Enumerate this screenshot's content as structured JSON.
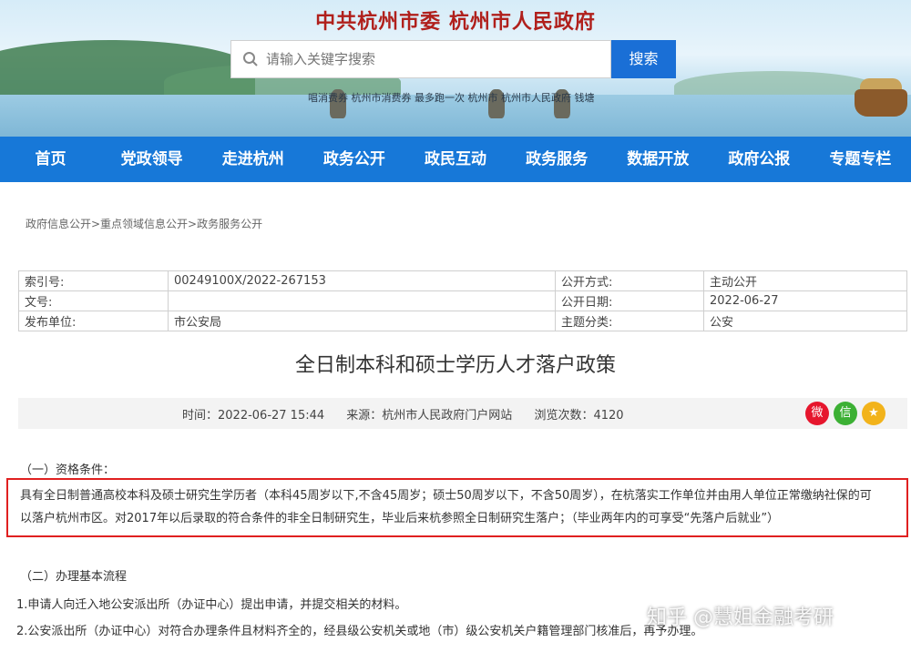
{
  "header": {
    "site_title": "中共杭州市委   杭州市人民政府",
    "search_placeholder": "请输入关键字搜索",
    "search_button": "搜索",
    "hot_links": "唱消费券  杭州市消费券  最多跑一次  杭州市  杭州市人民政府  钱塘"
  },
  "nav": {
    "items": [
      "首页",
      "党政领导",
      "走进杭州",
      "政务公开",
      "政民互动",
      "政务服务",
      "数据开放",
      "政府公报",
      "专题专栏"
    ]
  },
  "breadcrumb": "政府信息公开>重点领域信息公开>政务服务公开",
  "meta": {
    "index_label": "索引号:",
    "index_value": "00249100X/2022-267153",
    "open_method_label": "公开方式:",
    "open_method_value": "主动公开",
    "doc_no_label": "文号:",
    "doc_no_value": "",
    "open_date_label": "公开日期:",
    "open_date_value": "2022-06-27",
    "publisher_label": "发布单位:",
    "publisher_value": "市公安局",
    "topic_label": "主题分类:",
    "topic_value": "公安"
  },
  "article": {
    "title": "全日制本科和硕士学历人才落户政策",
    "time": "时间：2022-06-27 15:44",
    "source": "来源：杭州市人民政府门户网站",
    "views": "浏览次数：4120",
    "section1": "（一）资格条件：",
    "highlight_line1": "具有全日制普通高校本科及硕士研究生学历者（本科45周岁以下,不含45周岁；硕士50周岁以下，不含50周岁），在杭落实工作单位并由用人单位正常缴纳社保的可",
    "highlight_line2": "以落户杭州市区。对2017年以后录取的符合条件的非全日制研究生，毕业后来杭参照全日制研究生落户；（毕业两年内的可享受“先落户后就业”）",
    "section2": "（二）办理基本流程",
    "step1": "1.申请人向迁入地公安派出所（办证中心）提出申请，并提交相关的材料。",
    "step2": "2.公安派出所（办证中心）对符合办理条件且材料齐全的，经县级公安机关或地（市）级公安机关户籍管理部门核准后，再予办理。"
  },
  "share": {
    "weibo": "微",
    "wechat": "信",
    "fav": "★"
  },
  "watermark": "知乎 @慧姐金融考研",
  "colors": {
    "nav_bg": "#1778d8",
    "search_btn": "#1a6fd6",
    "title_red": "#b0201c",
    "highlight_border": "#e02020"
  }
}
